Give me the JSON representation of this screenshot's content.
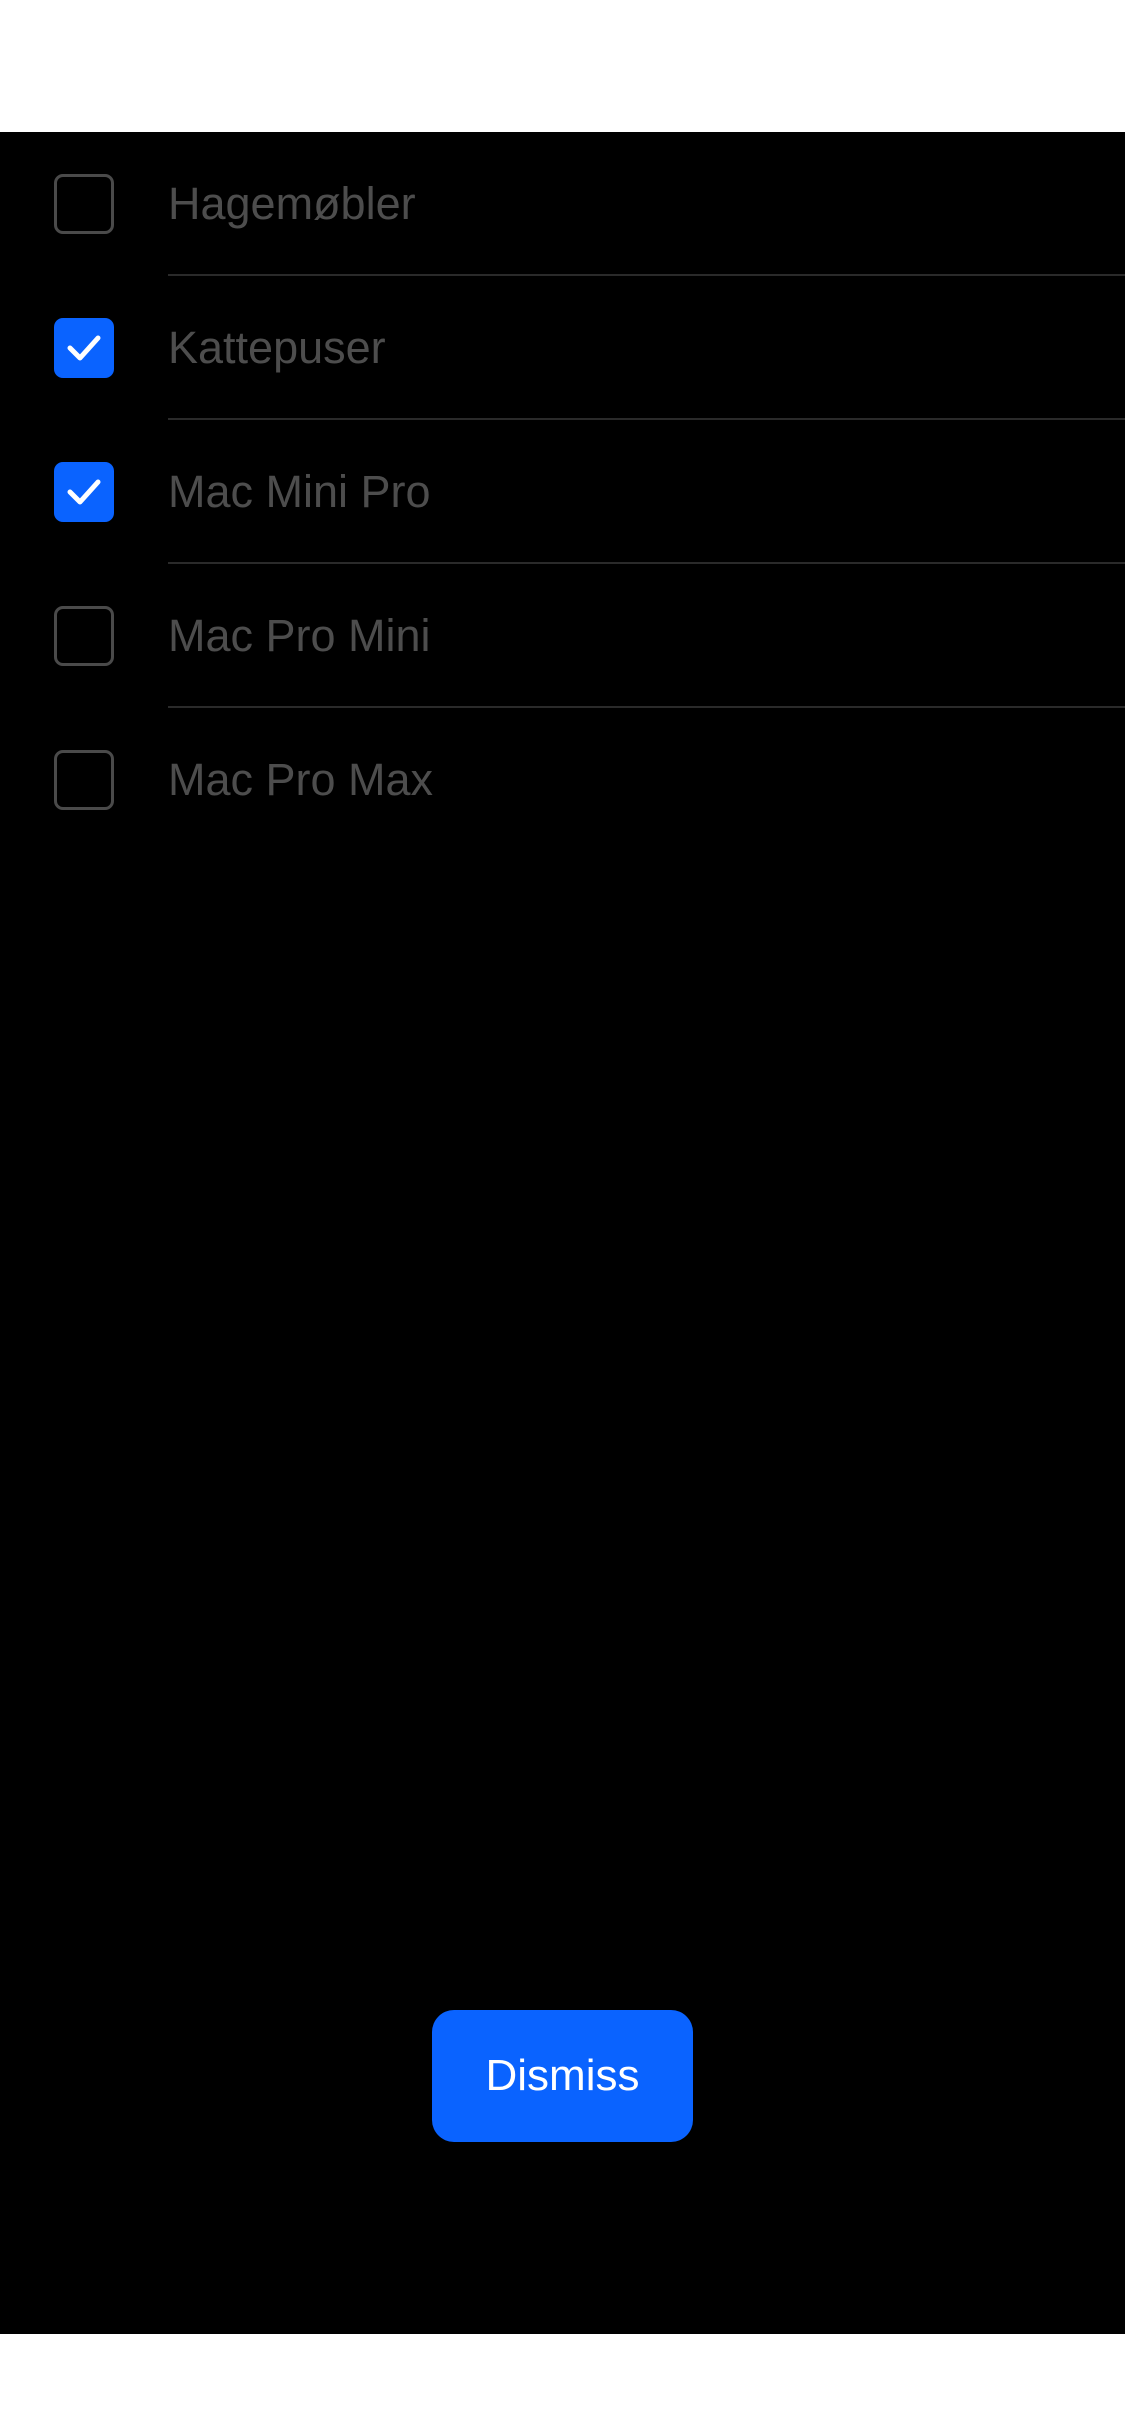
{
  "colors": {
    "accent": "#0a63ff",
    "background": "#000000",
    "label": "#4d4d4d",
    "checkbox_border": "#4a4a4a",
    "divider": "#2a2a2a"
  },
  "options": [
    {
      "label": "Hagemøbler",
      "checked": false
    },
    {
      "label": "Kattepuser",
      "checked": true
    },
    {
      "label": "Mac Mini Pro",
      "checked": true
    },
    {
      "label": "Mac Pro Mini",
      "checked": false
    },
    {
      "label": "Mac Pro Max",
      "checked": false
    }
  ],
  "dismiss_button": {
    "label": "Dismiss"
  },
  "icons": {
    "checked": "checkmark-icon"
  }
}
